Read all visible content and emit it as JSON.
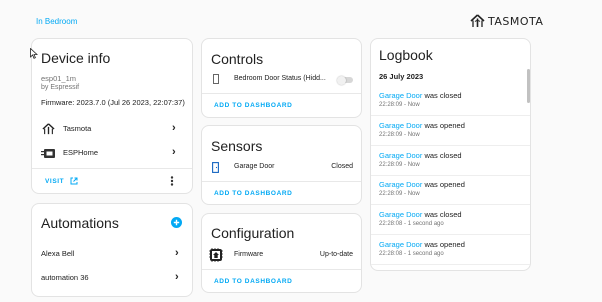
{
  "header": {
    "breadcrumb": "In Bedroom",
    "brand": "TASMOTA"
  },
  "device_info": {
    "title": "Device info",
    "name": "esp01_1m",
    "manufacturer": "by Espressif",
    "firmware": "Firmware: 2023.7.0 (Jul 26 2023, 22:07:37)",
    "integrations": [
      {
        "label": "Tasmota"
      },
      {
        "label": "ESPHome"
      }
    ],
    "visit_label": "VISIT",
    "more_icon": "more-vertical-icon"
  },
  "automations": {
    "title": "Automations",
    "items": [
      {
        "label": "Alexa Bell"
      },
      {
        "label": "automation 36"
      }
    ]
  },
  "controls": {
    "title": "Controls",
    "entity": "Bedroom Door Status (Hidd...",
    "toggle_on": false,
    "action": "ADD TO DASHBOARD"
  },
  "sensors": {
    "title": "Sensors",
    "entity": "Garage Door",
    "state": "Closed",
    "action": "ADD TO DASHBOARD"
  },
  "configuration": {
    "title": "Configuration",
    "entity": "Firmware",
    "state": "Up-to-date",
    "action": "ADD TO DASHBOARD"
  },
  "logbook": {
    "title": "Logbook",
    "date": "26 July 2023",
    "entries": [
      {
        "entity": "Garage Door",
        "event": "was closed",
        "time": "22:28:09 - Now"
      },
      {
        "entity": "Garage Door",
        "event": "was opened",
        "time": "22:28:09 - Now"
      },
      {
        "entity": "Garage Door",
        "event": "was closed",
        "time": "22:28:09 - Now"
      },
      {
        "entity": "Garage Door",
        "event": "was opened",
        "time": "22:28:09 - Now"
      },
      {
        "entity": "Garage Door",
        "event": "was closed",
        "time": "22:28:08 - 1 second ago"
      },
      {
        "entity": "Garage Door",
        "event": "was opened",
        "time": "22:28:08 - 1 second ago"
      }
    ]
  },
  "colors": {
    "accent": "#03a9f4",
    "background": "#fafafa",
    "card": "#ffffff"
  }
}
